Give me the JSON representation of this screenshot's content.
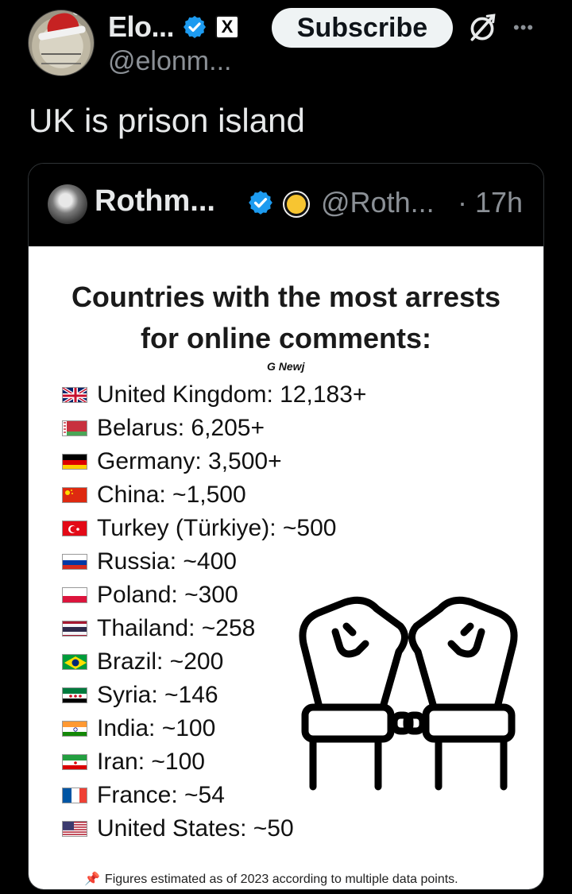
{
  "author": {
    "name": "Elo...",
    "handle": "@elonm...",
    "subscribe_label": "Subscribe",
    "more_label": "•••",
    "x_badge": "X"
  },
  "tweet": {
    "text": "UK is prison island"
  },
  "quote": {
    "name": "Rothm...",
    "handle": "@Roth...",
    "time": "· 17h",
    "image": {
      "title_line1": "Countries with the most arrests",
      "title_line2": "for online comments:",
      "watermark": "G Newj",
      "rows": [
        {
          "text": "United Kingdom: 12,183+",
          "flag": "uk"
        },
        {
          "text": "Belarus: 6,205+",
          "flag": "belarus"
        },
        {
          "text": "Germany: 3,500+",
          "flag": "germany"
        },
        {
          "text": "China: ~1,500",
          "flag": "china"
        },
        {
          "text": "Turkey (Türkiye): ~500",
          "flag": "turkey"
        },
        {
          "text": "Russia: ~400",
          "flag": "russia"
        },
        {
          "text": "Poland: ~300",
          "flag": "poland"
        },
        {
          "text": "Thailand: ~258",
          "flag": "thailand"
        },
        {
          "text": "Brazil: ~200",
          "flag": "brazil"
        },
        {
          "text": "Syria: ~146",
          "flag": "syria"
        },
        {
          "text": "India: ~100",
          "flag": "india"
        },
        {
          "text": "Iran: ~100",
          "flag": "iran"
        },
        {
          "text": "France: ~54",
          "flag": "france"
        },
        {
          "text": "United States: ~50",
          "flag": "usa"
        }
      ],
      "footnote": "Figures estimated as of 2023 according to multiple data points."
    }
  },
  "icons": {
    "verified": "verified-badge-icon",
    "grok": "grok-icon",
    "more": "more-options-icon",
    "handcuffs": "handcuffed-fists-icon",
    "pin": "pushpin-icon"
  },
  "colors": {
    "background": "#000000",
    "verified_blue": "#1d9bf0",
    "secondary_text": "#8b9096",
    "subscribe_bg": "#eff3f4"
  }
}
